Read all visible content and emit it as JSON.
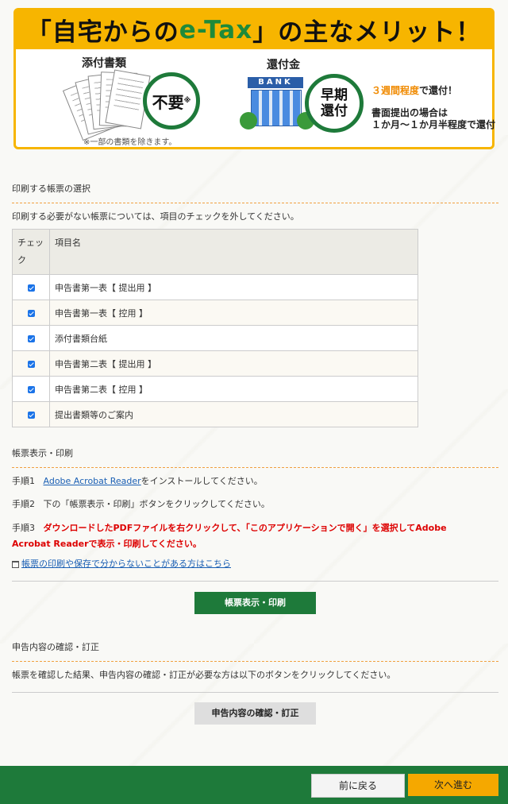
{
  "banner": {
    "title_pre": "「自宅からの",
    "title_etax": "e-Tax",
    "title_post": "」の主なメリット！",
    "doc_label": "添付書類",
    "circle_main": "不要",
    "circle_mark": "※",
    "note": "※一部の書類を除きます。",
    "refund_label": "還付金",
    "bank_sign": "BANK",
    "circle_fast_1": "早期",
    "circle_fast_2": "還付",
    "refund_weeks": "３週間程度",
    "refund_weeks_suffix": "で還付！",
    "paper_line1": "書面提出の場合は",
    "paper_line2": "１か月～１か月半程度で還付"
  },
  "print_select": {
    "title": "印刷する帳票の選択",
    "instruction": "印刷する必要がない帳票については、項目のチェックを外してください。",
    "col_check": "チェック",
    "col_name": "項目名",
    "rows": [
      {
        "label": "申告書第一表【 提出用 】",
        "checked": true
      },
      {
        "label": "申告書第一表【 控用 】",
        "checked": true
      },
      {
        "label": "添付書類台紙",
        "checked": true
      },
      {
        "label": "申告書第二表【 提出用 】",
        "checked": true
      },
      {
        "label": "申告書第二表【 控用 】",
        "checked": true
      },
      {
        "label": "提出書類等のご案内",
        "checked": true
      }
    ]
  },
  "display_print": {
    "title": "帳票表示・印刷",
    "step1_prefix": "手順1",
    "step1_link": "Adobe Acrobat Reader",
    "step1_suffix": "をインストールしてください。",
    "step2_prefix": "手順2",
    "step2_text": "下の「帳票表示・印刷」ボタンをクリックしてください。",
    "step3_prefix": "手順3",
    "step3_red_line1": "ダウンロードしたPDFファイルを右クリックして、「このアプリケーションで開く」を選択してAdobe",
    "step3_red_line2": "Acrobat Readerで表示・印刷してください。",
    "help_link": "帳票の印刷や保存で分からないことがある方はこちら",
    "button": "帳票表示・印刷"
  },
  "confirm": {
    "title": "申告内容の確認・訂正",
    "text": "帳票を確認した結果、申告内容の確認・訂正が必要な方は以下のボタンをクリックしてください。",
    "button": "申告内容の確認・訂正"
  },
  "footer": {
    "back": "前に戻る",
    "next": "次へ進む"
  }
}
